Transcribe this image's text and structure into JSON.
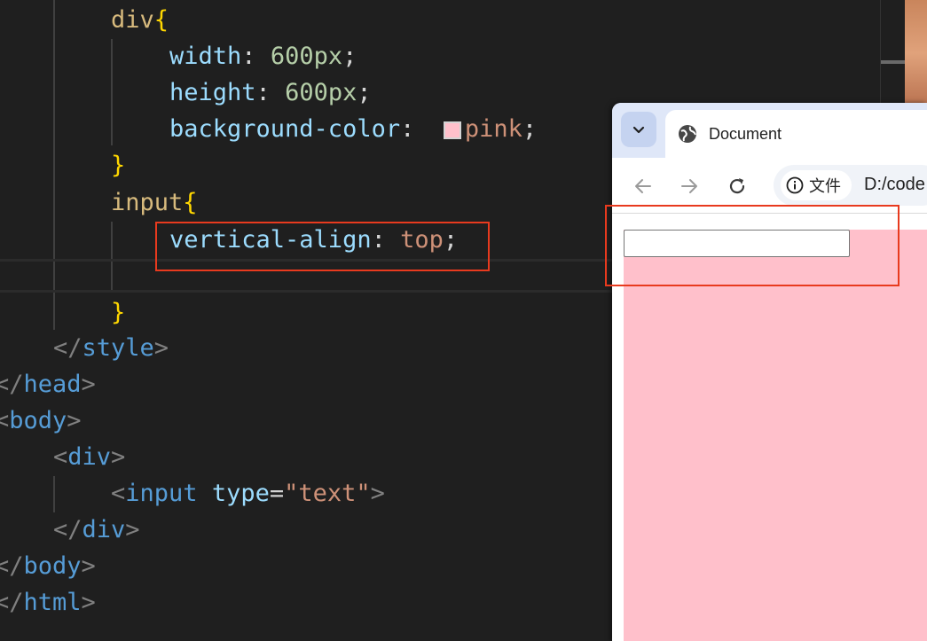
{
  "editor": {
    "lines": {
      "l1": {
        "sel": "div",
        "brace": "{"
      },
      "l2": {
        "prop": "width",
        "colon": ":",
        "num": "600px",
        "semi": ";"
      },
      "l3": {
        "prop": "height",
        "colon": ":",
        "num": "600px",
        "semi": ";"
      },
      "l4": {
        "prop": "background-color",
        "colon": ":",
        "val": "pink",
        "semi": ";"
      },
      "l5": {
        "brace": "}"
      },
      "l6": {
        "sel": "input",
        "brace": "{"
      },
      "l7": {
        "prop": "vertical-align",
        "colon": ":",
        "val": "top",
        "semi": ";"
      },
      "l9": {
        "brace": "}"
      },
      "l10": {
        "open": "</",
        "tag": "style",
        "close": ">"
      },
      "l11": {
        "open": "</",
        "tag": "head",
        "close": ">"
      },
      "l12": {
        "open": "<",
        "tag": "body",
        "close": ">"
      },
      "l13": {
        "open": "<",
        "tag": "div",
        "close": ">"
      },
      "l14": {
        "open": "<",
        "tag": "input",
        "attr": "type",
        "eq": "=",
        "val": "\"text\"",
        "close": ">"
      },
      "l15": {
        "open": "</",
        "tag": "div",
        "close": ">"
      },
      "l16": {
        "open": "</",
        "tag": "body",
        "close": ">"
      },
      "l17": {
        "open": "</",
        "tag": "html",
        "close": ">"
      }
    },
    "swatch_color": "#ffc0cb"
  },
  "browser": {
    "tab_title": "Document",
    "site_info_label": "文件",
    "url": "D:/code",
    "page_background": "#ffc0cb",
    "input_value": ""
  },
  "icons": {
    "tab_dropdown": "chevron-down-icon",
    "tab_favicon": "globe-icon",
    "back": "arrow-left-icon",
    "forward": "arrow-right-icon",
    "reload": "reload-icon",
    "site_info": "info-icon"
  },
  "colors": {
    "highlight": "#e83a1e",
    "editor_bg": "#1f1f1f"
  }
}
